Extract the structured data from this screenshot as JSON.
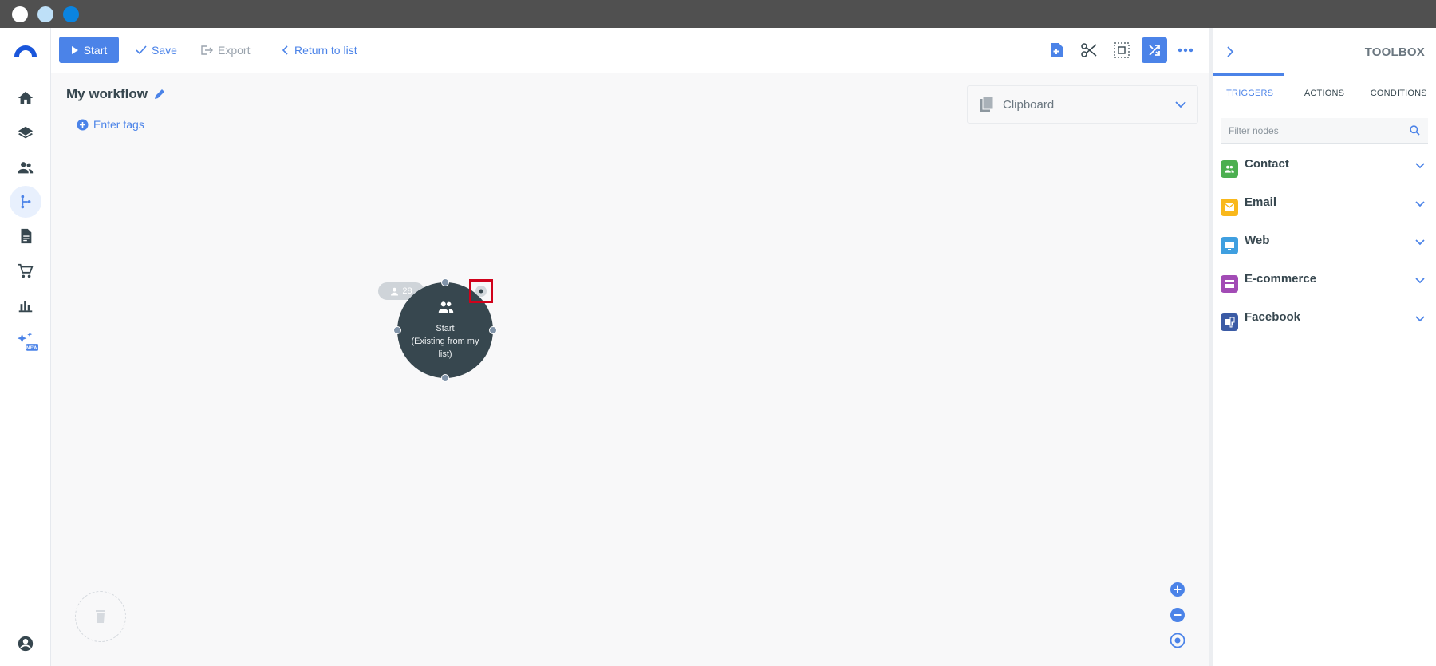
{
  "toolbar": {
    "start_label": "Start",
    "save_label": "Save",
    "export_label": "Export",
    "return_label": "Return to list"
  },
  "canvas": {
    "workflow_title": "My workflow",
    "enter_tags_label": "Enter tags",
    "clipboard_label": "Clipboard",
    "node": {
      "title": "Start",
      "subtitle": "(Existing from my list)",
      "contact_count": "28"
    }
  },
  "toolbox": {
    "title": "TOOLBOX",
    "tabs": [
      {
        "label": "TRIGGERS",
        "active": true
      },
      {
        "label": "ACTIONS",
        "active": false
      },
      {
        "label": "CONDITIONS",
        "active": false
      }
    ],
    "filter_placeholder": "Filter nodes",
    "categories": [
      {
        "label": "Contact",
        "icon": "contact-group-icon",
        "color": "#4caf50"
      },
      {
        "label": "Email",
        "icon": "envelope-icon",
        "color": "#f9b81b"
      },
      {
        "label": "Web",
        "icon": "monitor-icon",
        "color": "#3f9fe0"
      },
      {
        "label": "E-commerce",
        "icon": "card-icon",
        "color": "#a24bb5"
      },
      {
        "label": "Facebook",
        "icon": "facebook-icon",
        "color": "#3b5ba5"
      }
    ]
  },
  "nav": {
    "badge_new": "NEW"
  },
  "colors": {
    "accent": "#4b83e8",
    "node_bg": "#37474f",
    "highlight": "#d0021b"
  }
}
